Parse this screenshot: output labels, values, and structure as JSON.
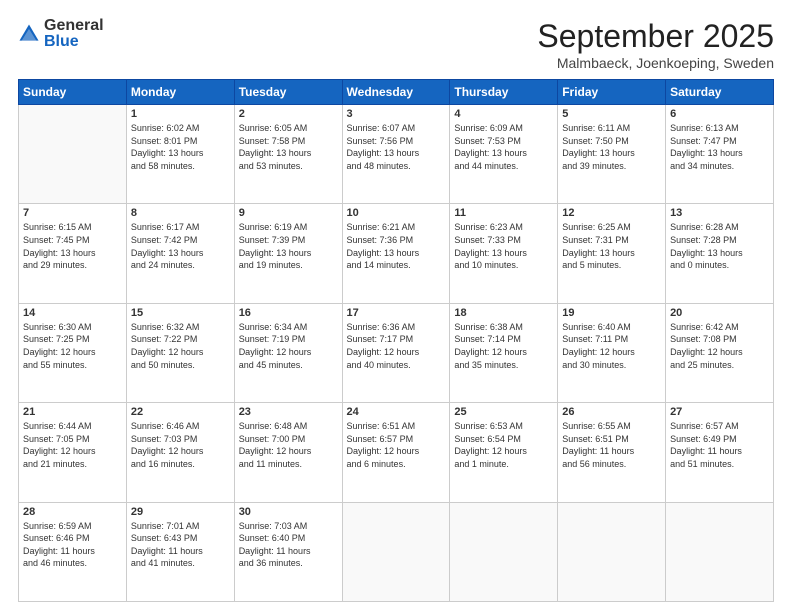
{
  "header": {
    "logo_general": "General",
    "logo_blue": "Blue",
    "month_title": "September 2025",
    "location": "Malmbaeck, Joenkoeping, Sweden"
  },
  "weekdays": [
    "Sunday",
    "Monday",
    "Tuesday",
    "Wednesday",
    "Thursday",
    "Friday",
    "Saturday"
  ],
  "weeks": [
    [
      {
        "day": "",
        "info": ""
      },
      {
        "day": "1",
        "info": "Sunrise: 6:02 AM\nSunset: 8:01 PM\nDaylight: 13 hours\nand 58 minutes."
      },
      {
        "day": "2",
        "info": "Sunrise: 6:05 AM\nSunset: 7:58 PM\nDaylight: 13 hours\nand 53 minutes."
      },
      {
        "day": "3",
        "info": "Sunrise: 6:07 AM\nSunset: 7:56 PM\nDaylight: 13 hours\nand 48 minutes."
      },
      {
        "day": "4",
        "info": "Sunrise: 6:09 AM\nSunset: 7:53 PM\nDaylight: 13 hours\nand 44 minutes."
      },
      {
        "day": "5",
        "info": "Sunrise: 6:11 AM\nSunset: 7:50 PM\nDaylight: 13 hours\nand 39 minutes."
      },
      {
        "day": "6",
        "info": "Sunrise: 6:13 AM\nSunset: 7:47 PM\nDaylight: 13 hours\nand 34 minutes."
      }
    ],
    [
      {
        "day": "7",
        "info": "Sunrise: 6:15 AM\nSunset: 7:45 PM\nDaylight: 13 hours\nand 29 minutes."
      },
      {
        "day": "8",
        "info": "Sunrise: 6:17 AM\nSunset: 7:42 PM\nDaylight: 13 hours\nand 24 minutes."
      },
      {
        "day": "9",
        "info": "Sunrise: 6:19 AM\nSunset: 7:39 PM\nDaylight: 13 hours\nand 19 minutes."
      },
      {
        "day": "10",
        "info": "Sunrise: 6:21 AM\nSunset: 7:36 PM\nDaylight: 13 hours\nand 14 minutes."
      },
      {
        "day": "11",
        "info": "Sunrise: 6:23 AM\nSunset: 7:33 PM\nDaylight: 13 hours\nand 10 minutes."
      },
      {
        "day": "12",
        "info": "Sunrise: 6:25 AM\nSunset: 7:31 PM\nDaylight: 13 hours\nand 5 minutes."
      },
      {
        "day": "13",
        "info": "Sunrise: 6:28 AM\nSunset: 7:28 PM\nDaylight: 13 hours\nand 0 minutes."
      }
    ],
    [
      {
        "day": "14",
        "info": "Sunrise: 6:30 AM\nSunset: 7:25 PM\nDaylight: 12 hours\nand 55 minutes."
      },
      {
        "day": "15",
        "info": "Sunrise: 6:32 AM\nSunset: 7:22 PM\nDaylight: 12 hours\nand 50 minutes."
      },
      {
        "day": "16",
        "info": "Sunrise: 6:34 AM\nSunset: 7:19 PM\nDaylight: 12 hours\nand 45 minutes."
      },
      {
        "day": "17",
        "info": "Sunrise: 6:36 AM\nSunset: 7:17 PM\nDaylight: 12 hours\nand 40 minutes."
      },
      {
        "day": "18",
        "info": "Sunrise: 6:38 AM\nSunset: 7:14 PM\nDaylight: 12 hours\nand 35 minutes."
      },
      {
        "day": "19",
        "info": "Sunrise: 6:40 AM\nSunset: 7:11 PM\nDaylight: 12 hours\nand 30 minutes."
      },
      {
        "day": "20",
        "info": "Sunrise: 6:42 AM\nSunset: 7:08 PM\nDaylight: 12 hours\nand 25 minutes."
      }
    ],
    [
      {
        "day": "21",
        "info": "Sunrise: 6:44 AM\nSunset: 7:05 PM\nDaylight: 12 hours\nand 21 minutes."
      },
      {
        "day": "22",
        "info": "Sunrise: 6:46 AM\nSunset: 7:03 PM\nDaylight: 12 hours\nand 16 minutes."
      },
      {
        "day": "23",
        "info": "Sunrise: 6:48 AM\nSunset: 7:00 PM\nDaylight: 12 hours\nand 11 minutes."
      },
      {
        "day": "24",
        "info": "Sunrise: 6:51 AM\nSunset: 6:57 PM\nDaylight: 12 hours\nand 6 minutes."
      },
      {
        "day": "25",
        "info": "Sunrise: 6:53 AM\nSunset: 6:54 PM\nDaylight: 12 hours\nand 1 minute."
      },
      {
        "day": "26",
        "info": "Sunrise: 6:55 AM\nSunset: 6:51 PM\nDaylight: 11 hours\nand 56 minutes."
      },
      {
        "day": "27",
        "info": "Sunrise: 6:57 AM\nSunset: 6:49 PM\nDaylight: 11 hours\nand 51 minutes."
      }
    ],
    [
      {
        "day": "28",
        "info": "Sunrise: 6:59 AM\nSunset: 6:46 PM\nDaylight: 11 hours\nand 46 minutes."
      },
      {
        "day": "29",
        "info": "Sunrise: 7:01 AM\nSunset: 6:43 PM\nDaylight: 11 hours\nand 41 minutes."
      },
      {
        "day": "30",
        "info": "Sunrise: 7:03 AM\nSunset: 6:40 PM\nDaylight: 11 hours\nand 36 minutes."
      },
      {
        "day": "",
        "info": ""
      },
      {
        "day": "",
        "info": ""
      },
      {
        "day": "",
        "info": ""
      },
      {
        "day": "",
        "info": ""
      }
    ]
  ]
}
